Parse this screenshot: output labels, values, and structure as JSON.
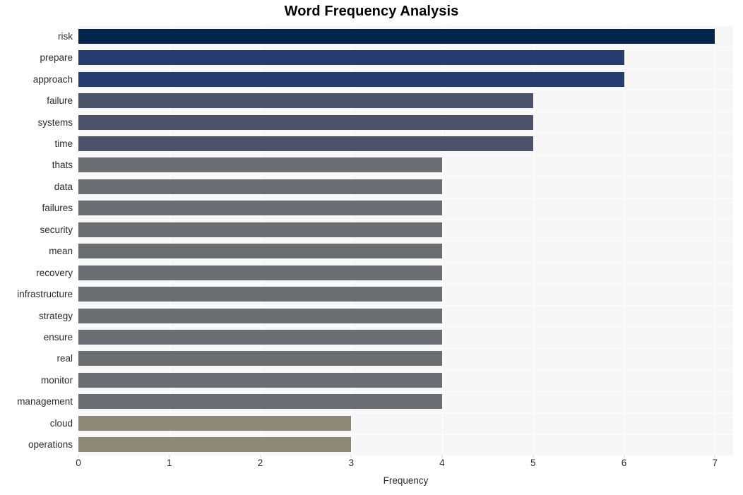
{
  "chart_data": {
    "type": "bar",
    "orientation": "horizontal",
    "title": "Word Frequency Analysis",
    "xlabel": "Frequency",
    "ylabel": "",
    "xlim": [
      0,
      7.2
    ],
    "xticks": [
      0,
      1,
      2,
      3,
      4,
      5,
      6,
      7
    ],
    "xtick_labels": [
      "0",
      "1",
      "2",
      "3",
      "4",
      "5",
      "6",
      "7"
    ],
    "grid": true,
    "grid_axis": "both",
    "legend": null,
    "categories": [
      "risk",
      "prepare",
      "approach",
      "failure",
      "systems",
      "time",
      "thats",
      "data",
      "failures",
      "security",
      "mean",
      "recovery",
      "infrastructure",
      "strategy",
      "ensure",
      "real",
      "monitor",
      "management",
      "cloud",
      "operations"
    ],
    "values": [
      7,
      6,
      6,
      5,
      5,
      5,
      4,
      4,
      4,
      4,
      4,
      4,
      4,
      4,
      4,
      4,
      4,
      4,
      3,
      3
    ],
    "bar_colors": [
      "#03244d",
      "#253d6e",
      "#253d6e",
      "#4c5269",
      "#4c5269",
      "#4c5269",
      "#6b6d73",
      "#6b6d73",
      "#6b6d73",
      "#6b6d73",
      "#6b6d73",
      "#6b6d73",
      "#6b6d73",
      "#6b6d73",
      "#6b6d73",
      "#6b6d73",
      "#6b6d73",
      "#6b6d73",
      "#8e8877",
      "#8e8877"
    ]
  },
  "style": {
    "plot_background": "#f7f7f8",
    "page_background": "#ffffff",
    "grid_color": "#ffffff",
    "text_color": "#2b2b2b",
    "title_color": "#000000"
  }
}
